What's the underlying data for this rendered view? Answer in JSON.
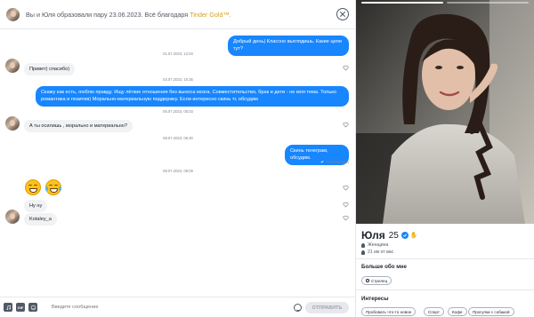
{
  "header": {
    "title_text": "Вы и Юля образовали пару 23.06.2023. Всё благодаря ",
    "brand_text": "Tinder Gold™."
  },
  "messages": {
    "out1": "Добрый день) Классно выглядишь. Какие цели тут?",
    "ts1": "01.07.2023, 12:04",
    "in1": "Привет) спасибо)",
    "ts2": "03.07.2023, 16:35",
    "out2": "Скажу как есть, люблю правду. Ищу лёгкие отношения без выноса мозга. Совместительство, брак и дети - не моя тема. Только романтика и позитив) Морально-материальную поддержку. Если интересно скинь тг, обсудим",
    "ts3": "05.07.2023, 05:03",
    "in2": "А ты осилишь , морально и материально?",
    "ts4": "09.07.2023, 05:30",
    "out3": "Скинь телеграм, обсудим.",
    "sent_label": "Отправлено",
    "ts5": "09.07.2023, 09:09",
    "in3": "Ну ну",
    "in4": "Kotaley_a"
  },
  "composer": {
    "placeholder": "Введите сообщение",
    "send_label": "ОТПРАВИТЬ",
    "gif_label": "GIF"
  },
  "profile": {
    "name": "Юля",
    "age": "25",
    "gender": "Женщина",
    "distance": "21 км от вас",
    "about_title": "Больше обо мне",
    "sign": "Стрелец",
    "interests_title": "Интересы",
    "interests": [
      "Пробовать что-то новое",
      "Спорт",
      "Кофе",
      "Прогулки с собакой"
    ]
  },
  "colors": {
    "accent": "#1786ff",
    "gold": "#d4a11e",
    "bubble_in": "#f0f2f4"
  }
}
